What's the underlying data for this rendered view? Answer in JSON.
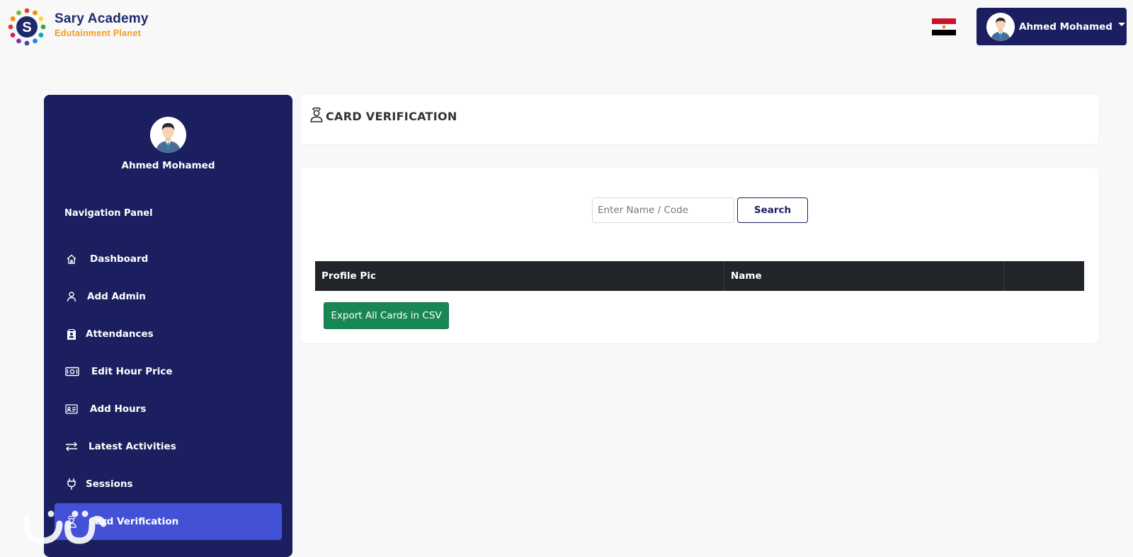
{
  "header": {
    "brand_name": "Sary Academy",
    "brand_tagline": "Edutainment Planet",
    "logo_letter": "S",
    "language_flag": "egypt-flag",
    "user_name": "Ahmed Mohamed"
  },
  "sidebar": {
    "user_name": "Ahmed Mohamed",
    "title": "Navigation Panel",
    "items": [
      {
        "label": "Dashboard",
        "icon": "home-icon"
      },
      {
        "label": "Add Admin",
        "icon": "user-icon"
      },
      {
        "label": "Attendances",
        "icon": "clipboard-icon"
      },
      {
        "label": "Edit Hour Price",
        "icon": "cash-icon"
      },
      {
        "label": "Add Hours",
        "icon": "id-card-icon"
      },
      {
        "label": "Latest Activities",
        "icon": "arrows-icon"
      },
      {
        "label": "Sessions",
        "icon": "plug-icon"
      },
      {
        "label": "Card Verification",
        "icon": "person-badge-icon",
        "active": true
      }
    ]
  },
  "page": {
    "title": "CARD VERIFICATION"
  },
  "search": {
    "placeholder": "Enter Name / Code",
    "value": "",
    "button_label": "Search"
  },
  "table": {
    "columns": [
      "Profile Pic",
      "Name",
      ""
    ]
  },
  "export_button_label": "Export All Cards in CSV",
  "colors": {
    "sidebar_bg": "#1b1f5f",
    "active_item": "#4351d6",
    "export_green": "#198754",
    "table_header": "#212529",
    "brand_orange": "#f59a1b"
  }
}
